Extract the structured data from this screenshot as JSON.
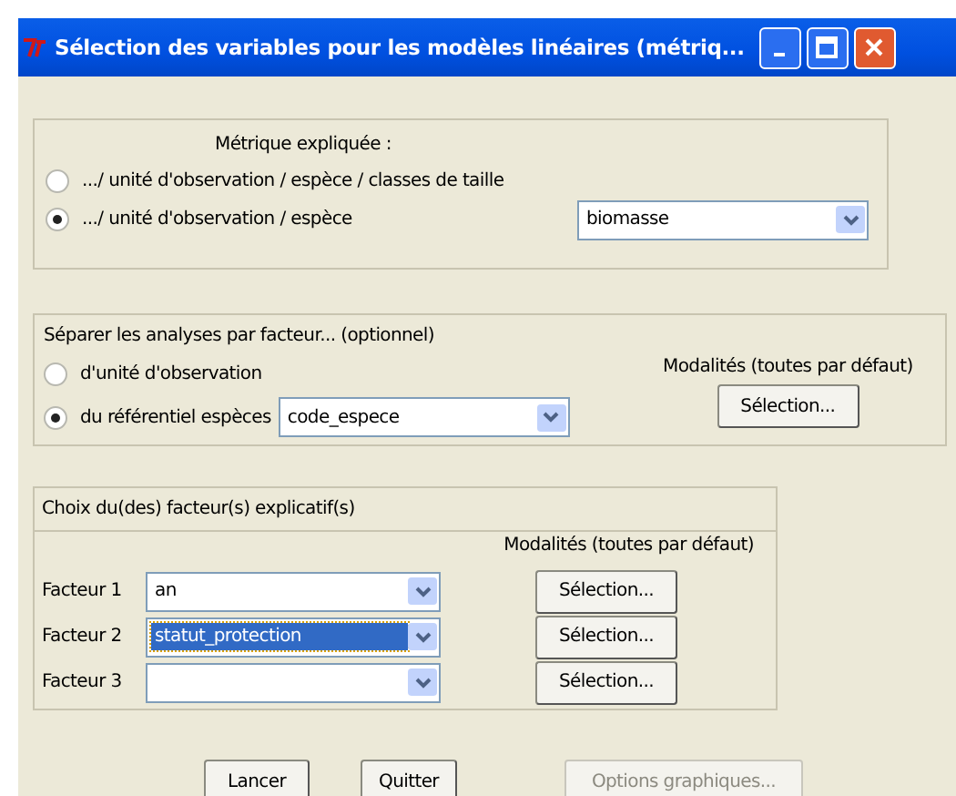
{
  "window": {
    "title": "Sélection des variables pour les modèles linéaires (métriq..."
  },
  "metric": {
    "title": "Métrique expliquée :",
    "options": [
      {
        "label": ".../ unité d'observation / espèce / classes de taille",
        "selected": false
      },
      {
        "label": ".../ unité d'observation / espèce",
        "selected": true
      }
    ],
    "dropdown": {
      "value": "biomasse"
    }
  },
  "separate": {
    "title": "Séparer les analyses par facteur...  (optionnel)",
    "modalities_label": "Modalités (toutes par défaut)",
    "options": [
      {
        "label": "d'unité d'observation",
        "selected": false
      },
      {
        "label": "du référentiel espèces",
        "selected": true
      }
    ],
    "dropdown": {
      "value": "code_espece"
    },
    "button": "Sélection..."
  },
  "factors": {
    "title": "Choix du(des) facteur(s) explicatif(s)",
    "modalities_label": "Modalités (toutes par défaut)",
    "rows": [
      {
        "label": "Facteur 1",
        "value": "an",
        "highlighted": false,
        "button": "Sélection..."
      },
      {
        "label": "Facteur 2",
        "value": "statut_protection",
        "highlighted": true,
        "button": "Sélection..."
      },
      {
        "label": "Facteur 3",
        "value": "",
        "highlighted": false,
        "button": "Sélection..."
      }
    ]
  },
  "buttons": [
    {
      "label": "Lancer",
      "disabled": false
    },
    {
      "label": "Quitter",
      "disabled": false
    },
    {
      "label": "Options graphiques...",
      "disabled": true
    }
  ]
}
